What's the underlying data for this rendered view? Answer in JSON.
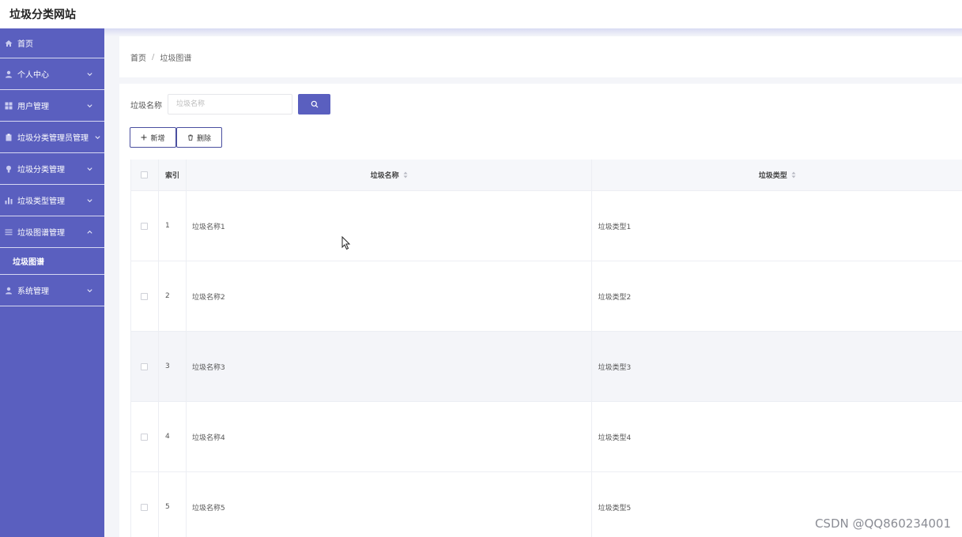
{
  "app": {
    "title": "垃圾分类网站"
  },
  "sidebar": {
    "items": [
      {
        "label": "首页",
        "icon": "home-icon",
        "chevron": ""
      },
      {
        "label": "个人中心",
        "icon": "user-icon",
        "chevron": "down"
      },
      {
        "label": "用户管理",
        "icon": "grid-icon",
        "chevron": "down"
      },
      {
        "label": "垃圾分类管理员管理",
        "icon": "clipboard-icon",
        "chevron": "down"
      },
      {
        "label": "垃圾分类管理",
        "icon": "bulb-icon",
        "chevron": "down"
      },
      {
        "label": "垃圾类型管理",
        "icon": "bar-chart-icon",
        "chevron": "down"
      },
      {
        "label": "垃圾图谱管理",
        "icon": "list-icon",
        "chevron": "up"
      },
      {
        "label": "系统管理",
        "icon": "user-icon",
        "chevron": "down"
      }
    ],
    "submenu": {
      "label": "垃圾图谱"
    }
  },
  "breadcrumb": {
    "home": "首页",
    "separator": "/",
    "current": "垃圾图谱"
  },
  "search": {
    "label": "垃圾名称",
    "placeholder": "垃圾名称",
    "value": ""
  },
  "actions": {
    "add_label": "新增",
    "delete_label": "删除"
  },
  "table": {
    "headers": {
      "index": "索引",
      "name": "垃圾名称",
      "type": "垃圾类型"
    },
    "rows": [
      {
        "index": "1",
        "name": "垃圾名称1",
        "type": "垃圾类型1"
      },
      {
        "index": "2",
        "name": "垃圾名称2",
        "type": "垃圾类型2"
      },
      {
        "index": "3",
        "name": "垃圾名称3",
        "type": "垃圾类型3"
      },
      {
        "index": "4",
        "name": "垃圾名称4",
        "type": "垃圾类型4"
      },
      {
        "index": "5",
        "name": "垃圾名称5",
        "type": "垃圾类型5"
      }
    ]
  },
  "watermark": "CSDN @QQ860234001",
  "colors": {
    "accent": "#5a5fbf",
    "sidebar_border": "#d6d8f2",
    "stripe": "#f4f5f9"
  }
}
